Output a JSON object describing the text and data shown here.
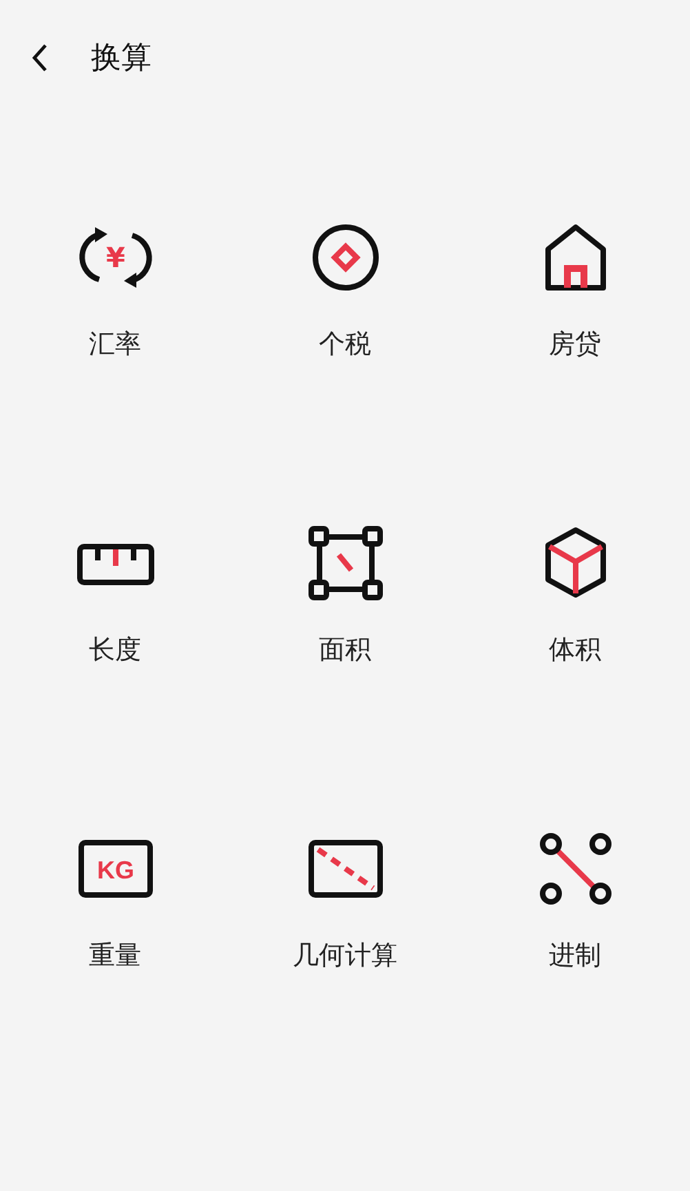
{
  "header": {
    "title": "换算"
  },
  "tools": [
    {
      "kind": "exchange",
      "label": "汇率",
      "glyph": "¥"
    },
    {
      "kind": "tax",
      "label": "个税"
    },
    {
      "kind": "house",
      "label": "房贷"
    },
    {
      "kind": "ruler",
      "label": "长度"
    },
    {
      "kind": "area",
      "label": "面积"
    },
    {
      "kind": "cube",
      "label": "体积"
    },
    {
      "kind": "weight",
      "label": "重量",
      "glyph": "KG"
    },
    {
      "kind": "geometry",
      "label": "几何计算"
    },
    {
      "kind": "base",
      "label": "进制"
    }
  ]
}
